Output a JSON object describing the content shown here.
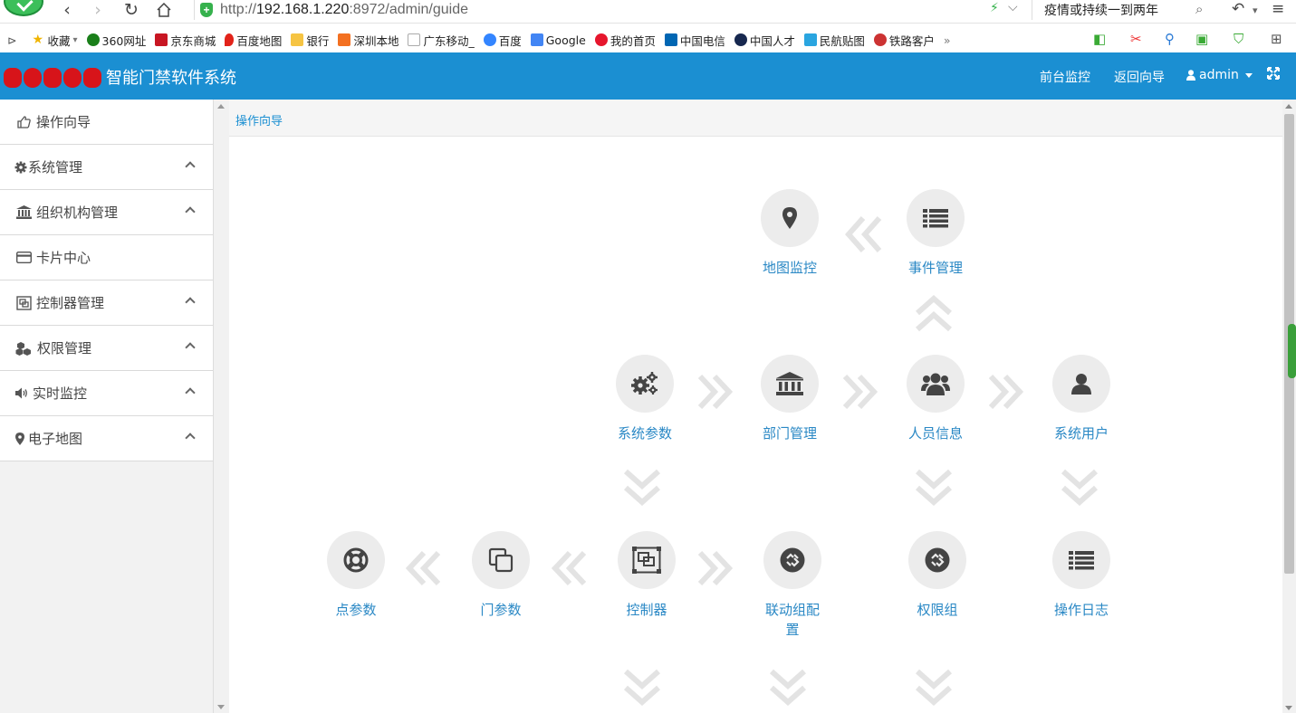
{
  "browser": {
    "url_prefix": "http://",
    "url_host": "192.168.1.220",
    "url_rest": ":8972/admin/guide",
    "search_text": "疫情或持续一到两年",
    "bookmarks": [
      "收藏",
      "360网址",
      "京东商城",
      "百度地图",
      "银行",
      "深圳本地",
      "广东移动_",
      "百度",
      "Google",
      "我的首页",
      "中国电信",
      "中国人才",
      "民航贴图",
      "铁路客户"
    ],
    "bookmarks_more": "»"
  },
  "header": {
    "title": "智能门禁软件系统",
    "link_monitor": "前台监控",
    "link_guide": "返回向导",
    "user": "admin"
  },
  "sidebar": {
    "items": [
      {
        "label": "操作向导",
        "icon": "thumbs-up-icon",
        "expandable": false
      },
      {
        "label": "系统管理",
        "icon": "gear-icon",
        "expandable": true
      },
      {
        "label": "组织机构管理",
        "icon": "bank-icon",
        "expandable": true
      },
      {
        "label": "卡片中心",
        "icon": "credit-card-icon",
        "expandable": false
      },
      {
        "label": "控制器管理",
        "icon": "controller-icon",
        "expandable": true
      },
      {
        "label": "权限管理",
        "icon": "cubes-icon",
        "expandable": true
      },
      {
        "label": "实时监控",
        "icon": "volume-icon",
        "expandable": true
      },
      {
        "label": "电子地图",
        "icon": "map-marker-icon",
        "expandable": true
      }
    ]
  },
  "breadcrumb": "操作向导",
  "guide": {
    "nodes": {
      "map_monitor": "地图监控",
      "event_mgmt": "事件管理",
      "sys_params": "系统参数",
      "dept_mgmt": "部门管理",
      "person_info": "人员信息",
      "sys_user": "系统用户",
      "point_params": "点参数",
      "door_params": "门参数",
      "controller": "控制器",
      "linkage_group": "联动组配置",
      "perm_group": "权限组",
      "op_log": "操作日志"
    }
  },
  "colors": {
    "header_bg": "#1b8fd2",
    "link_blue": "#2a88c5",
    "icon_dark": "#444444",
    "circle_bg": "#ececec",
    "arrow_grey": "#e3e3e3",
    "logo_red": "#d7141a"
  }
}
